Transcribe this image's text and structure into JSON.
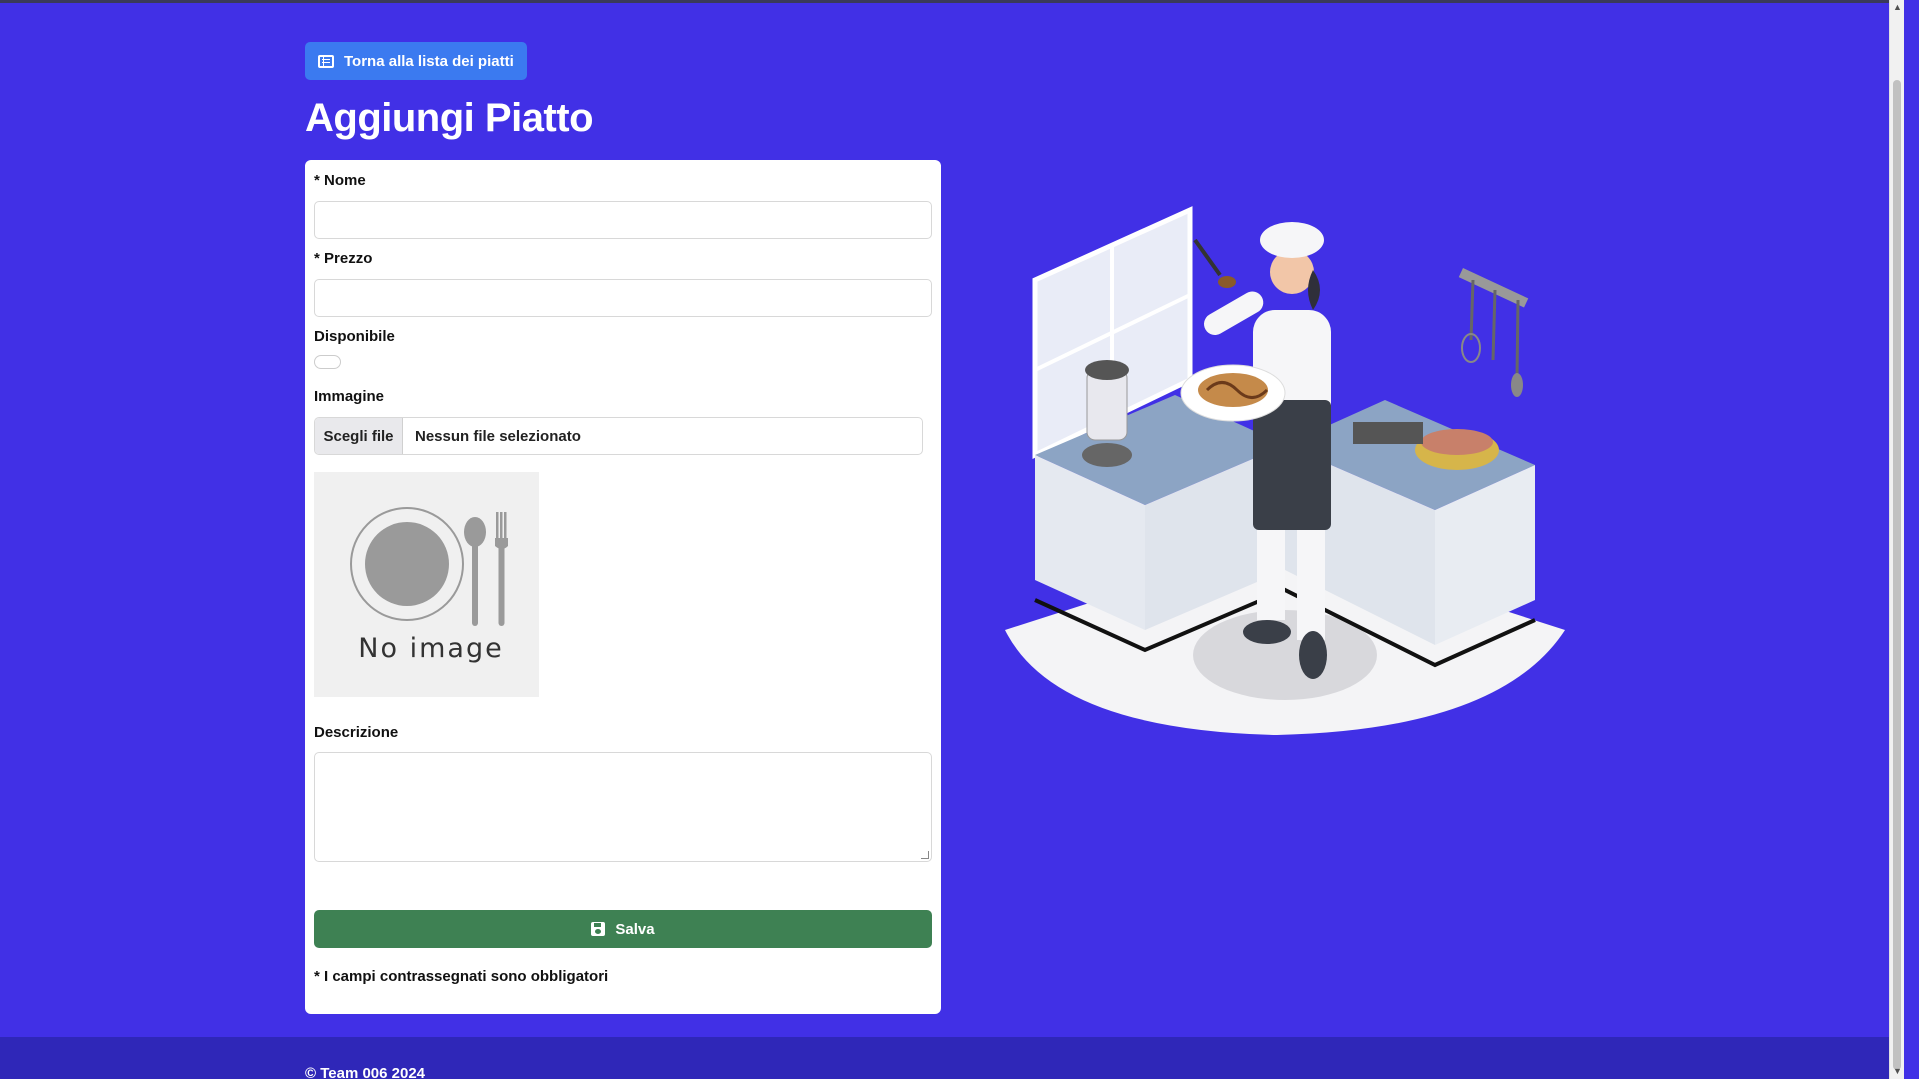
{
  "nav": {
    "back_label": "Torna alla lista dei piatti"
  },
  "page": {
    "title": "Aggiungi Piatto"
  },
  "form": {
    "nome_label": "* Nome",
    "nome_value": "",
    "prezzo_label": "* Prezzo",
    "prezzo_value": "",
    "disponibile_label": "Disponibile",
    "disponibile_checked": false,
    "immagine_label": "Immagine",
    "file_button": "Scegli file",
    "file_status": "Nessun file selezionato",
    "no_image_text": "No image",
    "descrizione_label": "Descrizione",
    "descrizione_value": "",
    "save_label": "Salva",
    "required_note": "* I campi contrassegnati sono obbligatori"
  },
  "footer": {
    "text": "© Team 006 2024"
  },
  "colors": {
    "background": "#4130e6",
    "footer": "#2f27b8",
    "back_button": "#3b7af0",
    "save_button": "#3e8153"
  },
  "illustration": {
    "subject": "chef-cooking-in-kitchen"
  }
}
